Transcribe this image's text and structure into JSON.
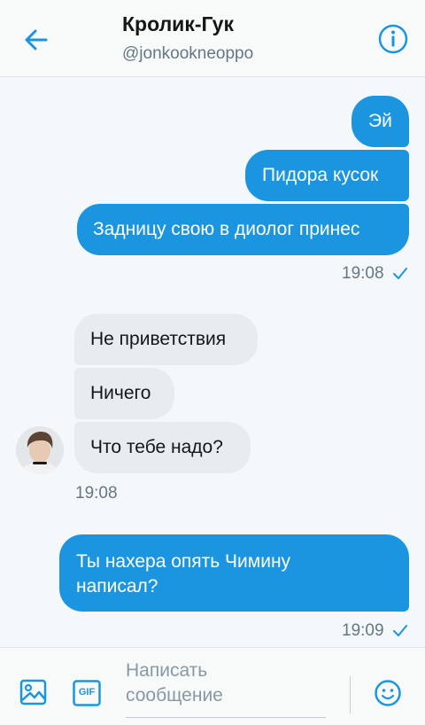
{
  "header": {
    "title": "Кролик-Гук",
    "handle": "@jonkookneoppo",
    "back_icon": "arrow-left-icon",
    "info_icon": "info-circle-icon"
  },
  "colors": {
    "accent": "#1b95e0",
    "incoming_bubble": "#e6ecf0",
    "muted_text": "#657786"
  },
  "messages": {
    "group1": {
      "direction": "outgoing",
      "items": [
        "Эй",
        "Пидора кусок",
        "Задницу свою в диолог принес"
      ],
      "time": "19:08",
      "status": "sent"
    },
    "group2": {
      "direction": "incoming",
      "items": [
        "Не приветствия",
        "Ничего",
        "Что тебе надо?"
      ],
      "time": "19:08"
    },
    "group3": {
      "direction": "outgoing",
      "line1": "Ты нахера опять Чимину",
      "line2": "написал?",
      "time": "19:09",
      "status": "sent"
    }
  },
  "composer": {
    "placeholder_line1": "Написать",
    "placeholder_line2": "сообщение",
    "image_icon": "image-icon",
    "gif_icon": "gif-icon",
    "gif_label": "GIF",
    "emoji_icon": "smiley-icon"
  }
}
